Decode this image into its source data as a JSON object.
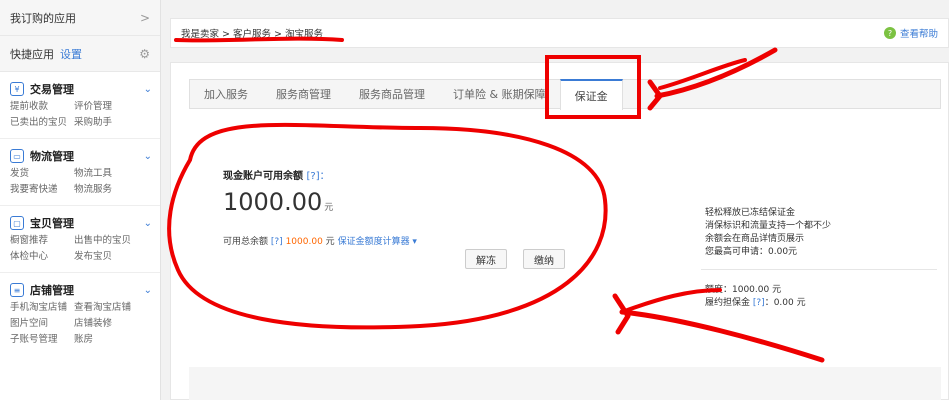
{
  "sidebar": {
    "my_apps": "我订购的应用",
    "my_apps_arrow": ">",
    "quick_apps": "快捷应用",
    "settings_link": "设置",
    "groups": [
      {
        "title": "交易管理",
        "links": [
          "提前收款",
          "评价管理",
          "已卖出的宝贝",
          "采购助手"
        ]
      },
      {
        "title": "物流管理",
        "links": [
          "发货",
          "物流工具",
          "我要寄快递",
          "物流服务"
        ]
      },
      {
        "title": "宝贝管理",
        "links": [
          "橱窗推荐",
          "出售中的宝贝",
          "体检中心",
          "发布宝贝"
        ]
      },
      {
        "title": "店铺管理",
        "links": [
          "手机淘宝店铺",
          "查看淘宝店铺",
          "图片空间",
          "店铺装修",
          "子账号管理",
          "账房"
        ]
      }
    ]
  },
  "topbar": {
    "breadcrumb": "我是卖家 > 客户服务 > 淘宝服务",
    "help": "查看帮助"
  },
  "tabs": [
    "加入服务",
    "服务商管理",
    "服务商品管理",
    "订单险 & 账期保障",
    "保证金"
  ],
  "account": {
    "label": "现金账户可用余额",
    "q": "[?]：",
    "amount": "1000.00",
    "unit": "元",
    "unfreeze_btn": "解冻",
    "pay_btn": "缴纳",
    "avail_prefix": "可用总余额",
    "avail_q": "[?]",
    "avail_value": "1000.00",
    "avail_unit": "元",
    "calc_link": "保证金额度计算器 ▾"
  },
  "right_info": {
    "lines": [
      "轻松释放已冻结保证金",
      "消保标识和流量支持一个都不少",
      "余额会在商品详情页展示",
      "您最高可申请：0.00元"
    ],
    "quota": "额度：1000.00 元",
    "guarantee_prefix": "履约担保金",
    "guarantee_q": "[?]",
    "guarantee_value": "：0.00 元"
  }
}
